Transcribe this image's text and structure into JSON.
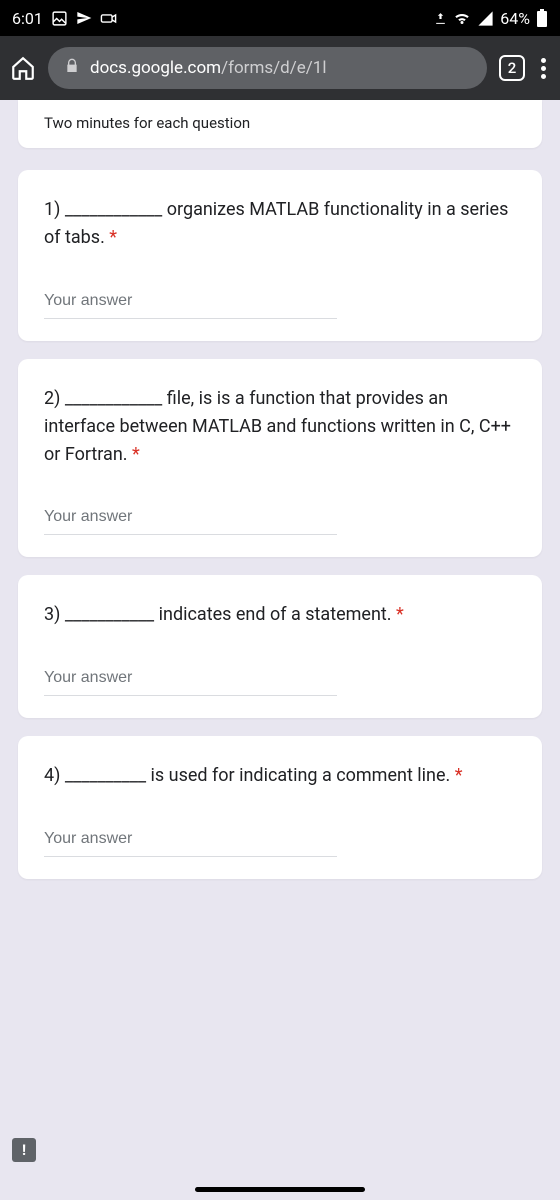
{
  "status": {
    "time": "6:01",
    "battery": "64%"
  },
  "browser": {
    "url_host": "docs.google.com",
    "url_path": "/forms/d/e/1l",
    "tab_count": "2"
  },
  "form": {
    "subtitle": "Two minutes for each question",
    "questions": [
      {
        "text": "1) ____________ organizes MATLAB functionality in a series of tabs. ",
        "required": "*",
        "placeholder": "Your answer"
      },
      {
        "text": "2) ____________ file, is is a function that provides an interface between MATLAB and functions written in C, C++ or Fortran. ",
        "required": "*",
        "placeholder": "Your answer"
      },
      {
        "text": "3) ___________ indicates end of a statement. ",
        "required": "*",
        "placeholder": "Your answer"
      },
      {
        "text": "4) __________ is used for indicating a comment line. ",
        "required": "*",
        "placeholder": "Your answer"
      }
    ]
  },
  "alert": "!"
}
